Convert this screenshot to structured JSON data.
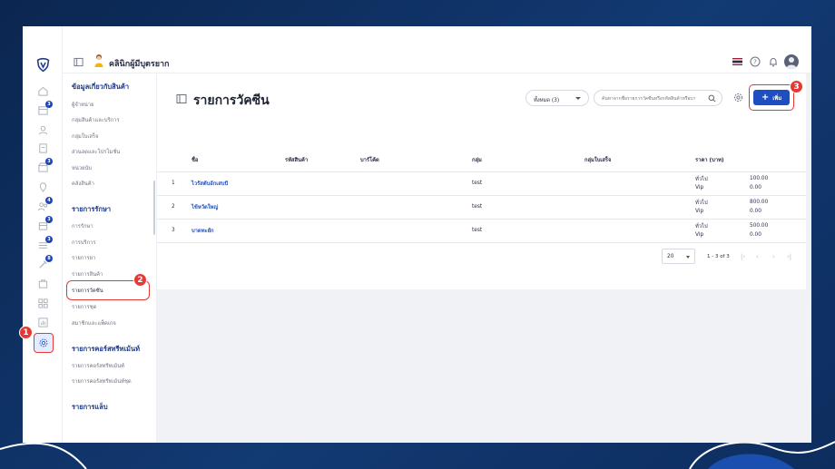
{
  "clinic": {
    "name": "คลินิกผู้มีบุตรยาก"
  },
  "side_menu": {
    "groups": [
      {
        "title": "ข้อมูลเกี่ยวกับสินค้า",
        "items": [
          "ผู้จำหน่าย",
          "กลุ่มสินค้าและบริการ",
          "กลุ่มใบเสร็จ",
          "ส่วนลดและโปรโมชั่น",
          "หน่วยนับ",
          "คลังสินค้า"
        ]
      },
      {
        "title": "รายการรักษา",
        "items": [
          "การรักษา",
          "การบริการ",
          "รายการยา",
          "รายการสินค้า",
          "รายการวัคซีน",
          "รายการชุด",
          "สมาชิกและแพ็คเกจ"
        ]
      },
      {
        "title": "รายการคอร์สทรีทเม้นท์",
        "items": [
          "รายการคอร์สทรีทเม้นท์",
          "รายการคอร์สทรีทเม้นท์ชุด"
        ]
      },
      {
        "title": "รายการแล็บ",
        "items": []
      }
    ],
    "active_item": "รายการวัคซีน"
  },
  "rail": {
    "badges": [
      "3",
      "3",
      "4",
      "3",
      "3",
      "8"
    ]
  },
  "page": {
    "title": "รายการวัคซีน",
    "filter_value": "ทั้งหมด (3)",
    "search_placeholder": "ค้นหาจากชื่อรายการวัคซีนหรือรหัสสินค้าหรือบา",
    "add_label": "เพิ่ม"
  },
  "table": {
    "columns": [
      "ชื่อ",
      "รหัสสินค้า",
      "บาร์โค้ด",
      "กลุ่ม",
      "กลุ่มใบเสร็จ",
      "ราคา (บาท)"
    ],
    "rows": [
      {
        "index": "1",
        "name": "ไวรัสตับอักเสบบี",
        "sku": "",
        "barcode": "",
        "group": "test",
        "receipt_group": "",
        "prices": [
          {
            "label": "ทั่วไป",
            "value": "100.00"
          },
          {
            "label": "Vip",
            "value": "0.00"
          }
        ]
      },
      {
        "index": "2",
        "name": "ไข้หวัดใหญ่",
        "sku": "",
        "barcode": "",
        "group": "test",
        "receipt_group": "",
        "prices": [
          {
            "label": "ทั่วไป",
            "value": "800.00"
          },
          {
            "label": "Vip",
            "value": "0.00"
          }
        ]
      },
      {
        "index": "3",
        "name": "บาดทะยัก",
        "sku": "",
        "barcode": "",
        "group": "test",
        "receipt_group": "",
        "prices": [
          {
            "label": "ทั่วไป",
            "value": "500.00"
          },
          {
            "label": "Vip",
            "value": "0.00"
          }
        ]
      }
    ]
  },
  "pagination": {
    "page_size": "20",
    "range": "1 - 3 of 3"
  },
  "markers": [
    "1",
    "2",
    "3"
  ],
  "colors": {
    "primary": "#1e4fc2",
    "marker": "#e53935",
    "heading": "#1e3a8a"
  }
}
